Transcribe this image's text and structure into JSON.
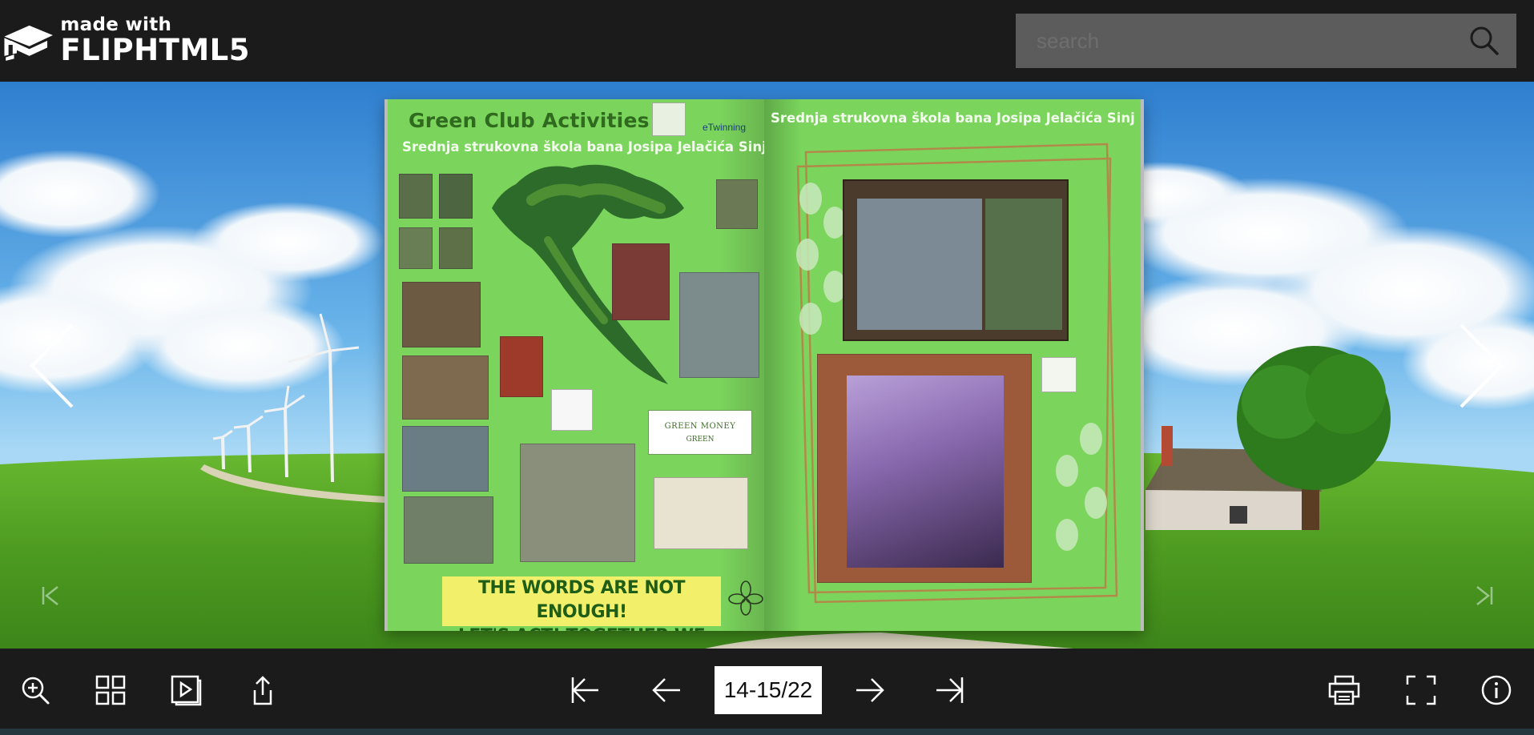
{
  "app": {
    "logo_small": "made with",
    "logo_big": "FLIPHTML5"
  },
  "search": {
    "placeholder": "search"
  },
  "book": {
    "left_page": {
      "title": "Green Club Activities",
      "subtitle": "Srednja strukovna škola bana Josipa Jelačića Sinj",
      "twinning_label": "eTwinning",
      "slogan_line1": "THE WORDS ARE NOT ENOUGH!",
      "slogan_line2": "LET'S ACT! TOGETHER WE ARE STRONG!",
      "green_money_main": "GREEN MONEY",
      "green_money_sub": "GREEN"
    },
    "right_page": {
      "subtitle": "Srednja strukovna škola bana Josipa Jelačića Sinj"
    }
  },
  "toolbar": {
    "page_indicator": "14-15/22"
  },
  "colors": {
    "page_green": "#7bd55d",
    "toolbar_bg": "#1b1b1b",
    "slogan_bg": "#f2f06a",
    "title_green": "#2f6a1f"
  }
}
